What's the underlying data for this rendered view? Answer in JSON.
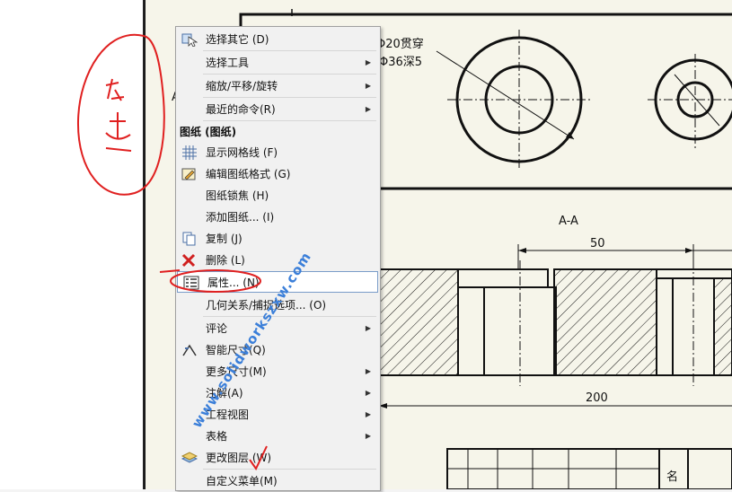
{
  "menu": {
    "items": [
      {
        "label": "选择其它 (D)",
        "icon": "select-other-icon",
        "submenu": false
      },
      {
        "label": "选择工具",
        "icon": "",
        "submenu": true
      },
      {
        "label": "缩放/平移/旋转",
        "icon": "",
        "submenu": true
      },
      {
        "label": "最近的命令(R)",
        "icon": "",
        "submenu": true
      },
      {
        "label": "显示网格线 (F)",
        "icon": "grid-icon",
        "submenu": false
      },
      {
        "label": "编辑图纸格式 (G)",
        "icon": "edit-sheet-format-icon",
        "submenu": false
      },
      {
        "label": "图纸锁焦 (H)",
        "icon": "",
        "submenu": false
      },
      {
        "label": "添加图纸... (I)",
        "icon": "",
        "submenu": false
      },
      {
        "label": "复制 (J)",
        "icon": "copy-icon",
        "submenu": false
      },
      {
        "label": "删除 (L)",
        "icon": "delete-icon",
        "submenu": false
      },
      {
        "label": "属性... (N)",
        "icon": "properties-icon",
        "submenu": false,
        "highlighted": true
      },
      {
        "label": "几何关系/捕捉选项... (O)",
        "icon": "",
        "submenu": false
      },
      {
        "label": "评论",
        "icon": "",
        "submenu": true
      },
      {
        "label": "智能尺寸(Q)",
        "icon": "smart-dimension-icon",
        "submenu": false
      },
      {
        "label": "更多尺寸(M)",
        "icon": "",
        "submenu": true
      },
      {
        "label": "注解(A)",
        "icon": "",
        "submenu": true
      },
      {
        "label": "工程视图",
        "icon": "",
        "submenu": true
      },
      {
        "label": "表格",
        "icon": "",
        "submenu": true
      },
      {
        "label": "更改图层 (W)",
        "icon": "change-layer-icon",
        "submenu": false
      },
      {
        "label": "自定义菜单(M)",
        "icon": "",
        "submenu": false
      }
    ],
    "section_header": "图纸 (图纸)"
  },
  "drawing": {
    "note_through": "Φ20贯穿",
    "note_depth": "Φ36深5",
    "section_label": "A-A",
    "dim_50": "50",
    "dim_200": "200",
    "left_letter": "A",
    "title_block_text": "名"
  },
  "annotation": {
    "handwritten": "右击"
  },
  "watermark": "www.solidworkszxw.com",
  "colors": {
    "accent": "#3b7fd9",
    "annotation": "#e02020",
    "sheet": "#f6f5ea"
  }
}
